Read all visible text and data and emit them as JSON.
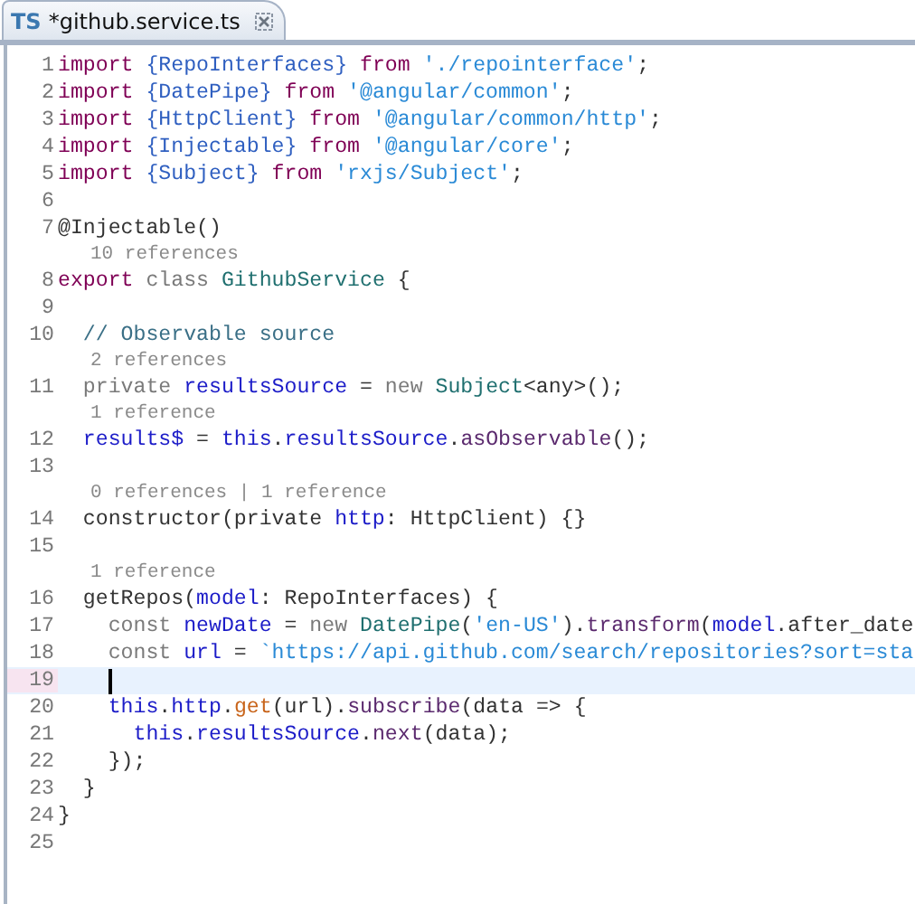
{
  "tab": {
    "badge": "TS",
    "title": "*github.service.ts",
    "selected": true
  },
  "lines": [
    {
      "kind": "code",
      "number": "1",
      "current": false,
      "tokens": [
        {
          "t": "import ",
          "kind": "keyword"
        },
        {
          "t": "{RepoInterfaces}",
          "kind": "import"
        },
        {
          "t": " from ",
          "kind": "keyword"
        },
        {
          "t": "'./repointerface'",
          "kind": "string"
        },
        {
          "t": ";",
          "kind": "plain"
        }
      ]
    },
    {
      "kind": "code",
      "number": "2",
      "current": false,
      "tokens": [
        {
          "t": "import ",
          "kind": "keyword"
        },
        {
          "t": "{DatePipe}",
          "kind": "import"
        },
        {
          "t": " from ",
          "kind": "keyword"
        },
        {
          "t": "'@angular/common'",
          "kind": "string"
        },
        {
          "t": ";",
          "kind": "plain"
        }
      ]
    },
    {
      "kind": "code",
      "number": "3",
      "current": false,
      "tokens": [
        {
          "t": "import ",
          "kind": "keyword"
        },
        {
          "t": "{HttpClient}",
          "kind": "import"
        },
        {
          "t": " from ",
          "kind": "keyword"
        },
        {
          "t": "'@angular/common/http'",
          "kind": "string"
        },
        {
          "t": ";",
          "kind": "plain"
        }
      ]
    },
    {
      "kind": "code",
      "number": "4",
      "current": false,
      "tokens": [
        {
          "t": "import ",
          "kind": "keyword"
        },
        {
          "t": "{Injectable}",
          "kind": "import"
        },
        {
          "t": " from ",
          "kind": "keyword"
        },
        {
          "t": "'@angular/core'",
          "kind": "string"
        },
        {
          "t": ";",
          "kind": "plain"
        }
      ]
    },
    {
      "kind": "code",
      "number": "5",
      "current": false,
      "tokens": [
        {
          "t": "import ",
          "kind": "keyword"
        },
        {
          "t": "{Subject}",
          "kind": "import"
        },
        {
          "t": " from ",
          "kind": "keyword"
        },
        {
          "t": "'rxjs/Subject'",
          "kind": "string"
        },
        {
          "t": ";",
          "kind": "plain"
        }
      ]
    },
    {
      "kind": "code",
      "number": "6",
      "current": false
    },
    {
      "kind": "code",
      "number": "7",
      "current": false,
      "tokens": [
        {
          "t": "@Injectable()",
          "kind": "plain"
        }
      ]
    },
    {
      "kind": "lens",
      "text": "10 references"
    },
    {
      "kind": "code",
      "number": "8",
      "current": false,
      "tokens": [
        {
          "t": "export ",
          "kind": "keyword"
        },
        {
          "t": "class ",
          "kind": "soft"
        },
        {
          "t": "GithubService",
          "kind": "type"
        },
        {
          "t": " {",
          "kind": "plain"
        }
      ]
    },
    {
      "kind": "code",
      "number": "9",
      "current": false
    },
    {
      "kind": "code",
      "number": "10",
      "current": false,
      "tokens": [
        {
          "t": "  // Observable source",
          "kind": "comment"
        }
      ]
    },
    {
      "kind": "lens",
      "text": "2 references"
    },
    {
      "kind": "code",
      "number": "11",
      "current": false,
      "tokens": [
        {
          "t": "  private ",
          "kind": "soft"
        },
        {
          "t": "resultsSource",
          "kind": "variable"
        },
        {
          "t": " = ",
          "kind": "plain"
        },
        {
          "t": "new ",
          "kind": "soft"
        },
        {
          "t": "Subject",
          "kind": "type"
        },
        {
          "t": "<any>();",
          "kind": "plain"
        }
      ]
    },
    {
      "kind": "lens",
      "text": "1 reference"
    },
    {
      "kind": "code",
      "number": "12",
      "current": false,
      "tokens": [
        {
          "t": "  results$",
          "kind": "variable"
        },
        {
          "t": " = ",
          "kind": "plain"
        },
        {
          "t": "this",
          "kind": "variable"
        },
        {
          "t": ".",
          "kind": "plain"
        },
        {
          "t": "resultsSource",
          "kind": "variable"
        },
        {
          "t": ".",
          "kind": "plain"
        },
        {
          "t": "asObservable",
          "kind": "method"
        },
        {
          "t": "();",
          "kind": "plain"
        }
      ]
    },
    {
      "kind": "code",
      "number": "13",
      "current": false
    },
    {
      "kind": "lens",
      "text": "0 references | 1 reference"
    },
    {
      "kind": "code",
      "number": "14",
      "current": false,
      "tokens": [
        {
          "t": "  constructor(private ",
          "kind": "plain"
        },
        {
          "t": "http",
          "kind": "variable"
        },
        {
          "t": ": HttpClient) {}",
          "kind": "plain"
        }
      ]
    },
    {
      "kind": "code",
      "number": "15",
      "current": false
    },
    {
      "kind": "lens",
      "text": "1 reference"
    },
    {
      "kind": "code",
      "number": "16",
      "current": false,
      "tokens": [
        {
          "t": "  getRepos(",
          "kind": "plain"
        },
        {
          "t": "model",
          "kind": "variable"
        },
        {
          "t": ": RepoInterfaces) {",
          "kind": "plain"
        }
      ]
    },
    {
      "kind": "code",
      "number": "17",
      "current": false,
      "tokens": [
        {
          "t": "    const ",
          "kind": "soft"
        },
        {
          "t": "newDate",
          "kind": "variable"
        },
        {
          "t": " = ",
          "kind": "plain"
        },
        {
          "t": "new ",
          "kind": "soft"
        },
        {
          "t": "DatePipe",
          "kind": "type"
        },
        {
          "t": "(",
          "kind": "plain"
        },
        {
          "t": "'en-US'",
          "kind": "string"
        },
        {
          "t": ").",
          "kind": "plain"
        },
        {
          "t": "transform",
          "kind": "method"
        },
        {
          "t": "(",
          "kind": "plain"
        },
        {
          "t": "model",
          "kind": "variable"
        },
        {
          "t": ".after_date",
          "kind": "plain"
        }
      ]
    },
    {
      "kind": "code",
      "number": "18",
      "current": false,
      "tokens": [
        {
          "t": "    const ",
          "kind": "soft"
        },
        {
          "t": "url",
          "kind": "variable"
        },
        {
          "t": " = ",
          "kind": "plain"
        },
        {
          "t": "`https://api.github.com/search/repositories?sort=sta",
          "kind": "string"
        }
      ]
    },
    {
      "kind": "code",
      "number": "19",
      "current": true
    },
    {
      "kind": "code",
      "number": "20",
      "current": false,
      "tokens": [
        {
          "t": "    this",
          "kind": "variable"
        },
        {
          "t": ".",
          "kind": "plain"
        },
        {
          "t": "http",
          "kind": "variable"
        },
        {
          "t": ".",
          "kind": "plain"
        },
        {
          "t": "get",
          "kind": "call"
        },
        {
          "t": "(url).",
          "kind": "plain"
        },
        {
          "t": "subscribe",
          "kind": "method"
        },
        {
          "t": "(data => {",
          "kind": "plain"
        }
      ]
    },
    {
      "kind": "code",
      "number": "21",
      "current": false,
      "tokens": [
        {
          "t": "      this",
          "kind": "variable"
        },
        {
          "t": ".",
          "kind": "plain"
        },
        {
          "t": "resultsSource",
          "kind": "variable"
        },
        {
          "t": ".",
          "kind": "plain"
        },
        {
          "t": "next",
          "kind": "method"
        },
        {
          "t": "(data);",
          "kind": "plain"
        }
      ]
    },
    {
      "kind": "code",
      "number": "22",
      "current": false,
      "tokens": [
        {
          "t": "    });",
          "kind": "plain"
        }
      ]
    },
    {
      "kind": "code",
      "number": "23",
      "current": false,
      "tokens": [
        {
          "t": "  }",
          "kind": "plain"
        }
      ]
    },
    {
      "kind": "code",
      "number": "24",
      "current": false,
      "tokens": [
        {
          "t": "}",
          "kind": "plain"
        }
      ]
    },
    {
      "kind": "code",
      "number": "25",
      "current": false
    }
  ]
}
